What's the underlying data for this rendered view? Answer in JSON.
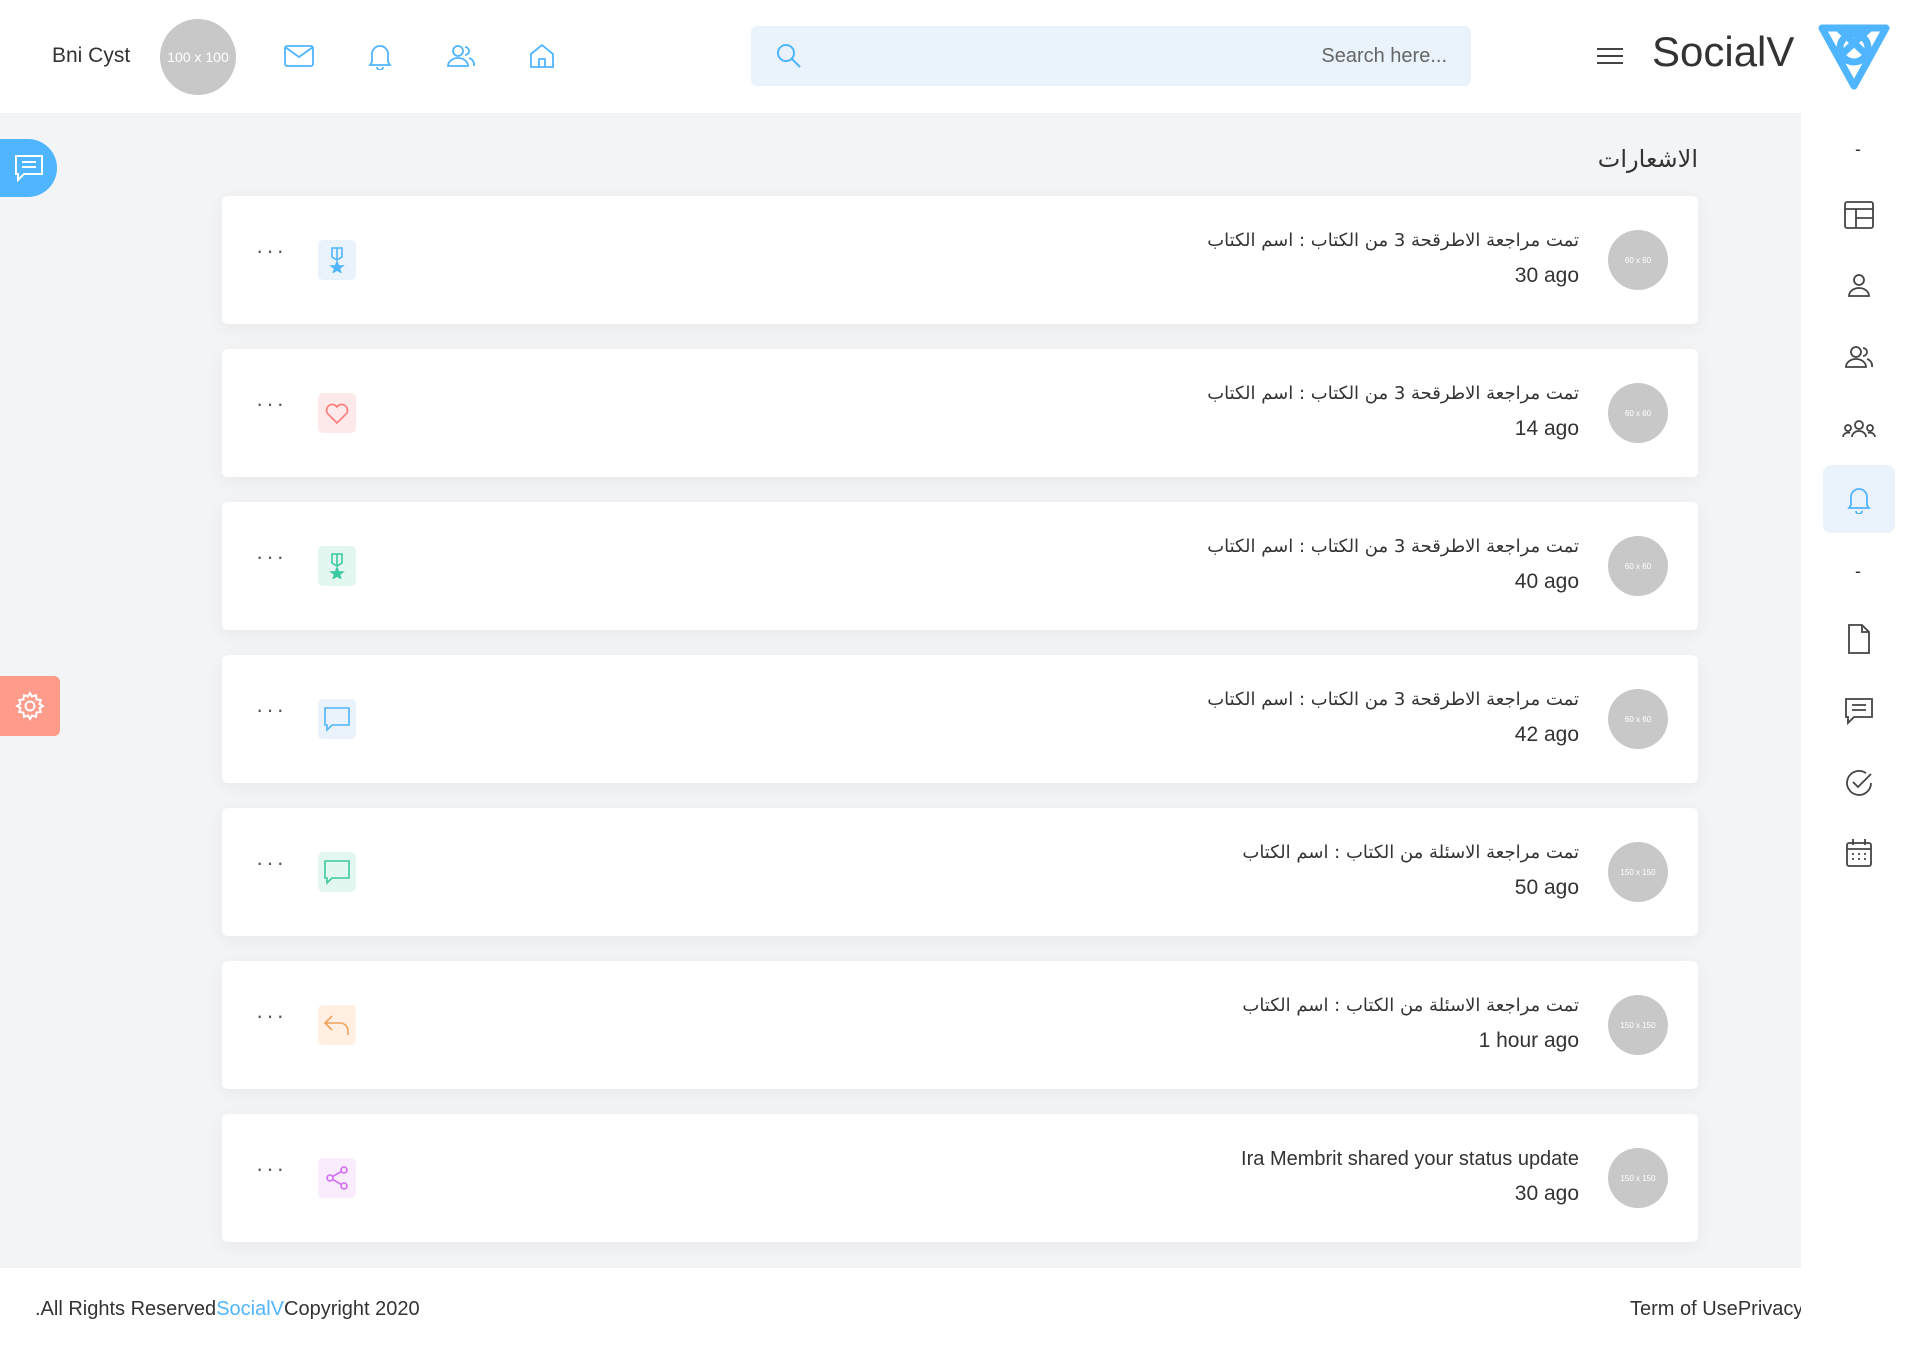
{
  "header": {
    "user_name": "Bni Cyst",
    "avatar_text": "100 x 100",
    "search_placeholder": "Search here...",
    "brand": "SocialV",
    "icons": [
      "mail-icon",
      "bell-icon",
      "friends-icon",
      "home-icon"
    ]
  },
  "sidenav": {
    "items": [
      "newsfeed-icon",
      "profile-icon",
      "friends-icon",
      "groups-icon",
      "notifications-icon",
      "file-icon",
      "chat-icon",
      "todo-icon",
      "calendar-icon"
    ],
    "active": "notifications-icon",
    "separator": "-"
  },
  "page": {
    "title": "الاشعارات"
  },
  "notifications": [
    {
      "avatar": "60 x 60",
      "title": "تمت مراجعة الاطرقحة 3 من الكتاب : اسم الكتاب",
      "time": "30 ago",
      "badge_icon": "medal-icon",
      "badge_color": "#50b5ff",
      "badge_bg": "#eaf3fc"
    },
    {
      "avatar": "60 x 60",
      "title": "تمت مراجعة الاطرقحة 3 من الكتاب : اسم الكتاب",
      "time": "14 ago",
      "badge_icon": "heart-icon",
      "badge_color": "#ff7a7a",
      "badge_bg": "#fde9e9"
    },
    {
      "avatar": "60 x 60",
      "title": "تمت مراجعة الاطرقحة 3 من الكتاب : اسم الكتاب",
      "time": "40 ago",
      "badge_icon": "medal-icon",
      "badge_color": "#3cc8a0",
      "badge_bg": "#e3f7f1"
    },
    {
      "avatar": "60 x 60",
      "title": "تمت مراجعة الاطرقحة 3 من الكتاب : اسم الكتاب",
      "time": "42 ago",
      "badge_icon": "chat-icon",
      "badge_color": "#50b5ff",
      "badge_bg": "#eaf3fc"
    },
    {
      "avatar": "150 x 150",
      "title": "تمت مراجعة الاسئلة من الكتاب : اسم الكتاب",
      "time": "50 ago",
      "badge_icon": "chat-icon",
      "badge_color": "#3cc8a0",
      "badge_bg": "#e3f7f1"
    },
    {
      "avatar": "150 x 150",
      "title": "تمت مراجعة الاسئلة من الكتاب : اسم الكتاب",
      "time": "1 hour ago",
      "badge_icon": "reply-icon",
      "badge_color": "#f5a05a",
      "badge_bg": "#fff0e3"
    },
    {
      "avatar": "150 x 150",
      "title": "Ira Membrit shared your status update",
      "time": "30 ago",
      "badge_icon": "share-icon",
      "badge_color": "#d36bf5",
      "badge_bg": "#f8ecfd"
    }
  ],
  "more_label": "···",
  "footer": {
    "copyright_prefix": ".All Rights Reserved",
    "copyright_link": "SocialV",
    "copyright_suffix": "Copyright 2020",
    "terms": "Term of Use",
    "privacy": "Privacy Policy"
  }
}
